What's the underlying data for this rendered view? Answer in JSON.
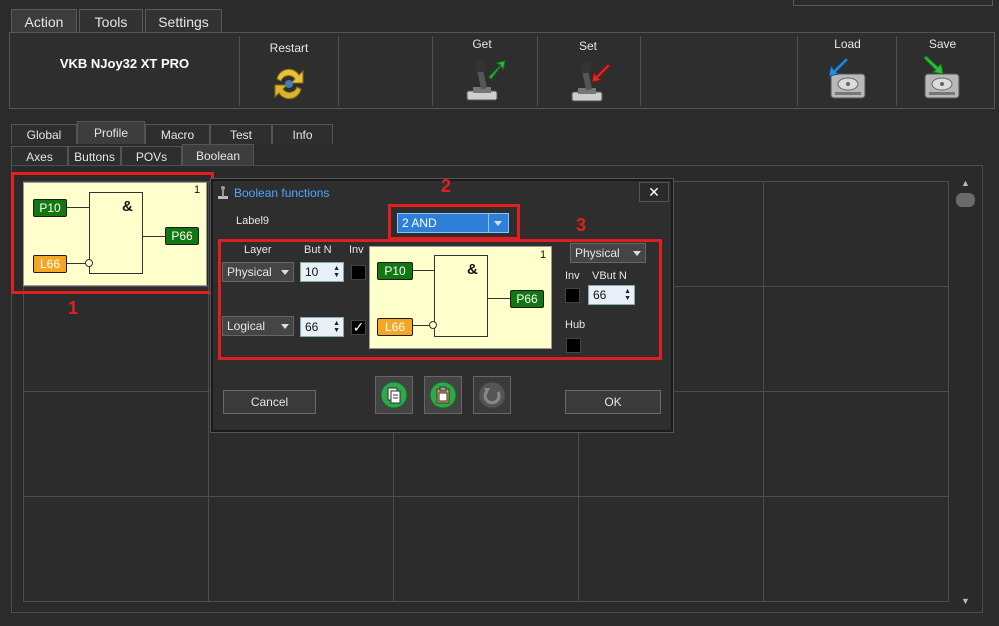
{
  "menu": {
    "tabs": [
      {
        "label": "Action",
        "active": true
      },
      {
        "label": "Tools",
        "active": false
      },
      {
        "label": "Settings",
        "active": false
      }
    ]
  },
  "toolbar": {
    "device_name": "VKB NJoy32 XT PRO",
    "restart_label": "Restart",
    "get_label": "Get",
    "set_label": "Set",
    "load_label": "Load",
    "save_label": "Save"
  },
  "section_tabs": [
    {
      "label": "Global",
      "active": false
    },
    {
      "label": "Profile",
      "active": true
    },
    {
      "label": "Macro",
      "active": false
    },
    {
      "label": "Test",
      "active": false
    },
    {
      "label": "Info",
      "active": false
    }
  ],
  "sub_tabs": [
    {
      "label": "Axes",
      "active": false
    },
    {
      "label": "Buttons",
      "active": false
    },
    {
      "label": "POVs",
      "active": false
    },
    {
      "label": "Boolean",
      "active": true
    }
  ],
  "gate_tile": {
    "number": "1",
    "input_a": "P10",
    "input_b": "L66",
    "output": "P66",
    "operator": "&"
  },
  "annotations": {
    "one": "1",
    "two": "2",
    "three": "3"
  },
  "dialog": {
    "title": "Boolean functions",
    "close": "✕",
    "label_name": "Label9",
    "function": "2 AND",
    "col_layer": "Layer",
    "col_butn": "But N",
    "col_inv": "Inv",
    "row1": {
      "layer": "Physical",
      "button": "10",
      "inv": ""
    },
    "row2": {
      "layer": "Logical",
      "button": "66",
      "inv": "✓"
    },
    "preview": {
      "number": "1",
      "input_a": "P10",
      "input_b": "L66",
      "output": "P66",
      "operator": "&"
    },
    "output_layer": "Physical",
    "out_inv_label": "Inv",
    "vbutn_label": "VBut N",
    "vbutn_value": "66",
    "hub_label": "Hub",
    "cancel_label": "Cancel",
    "ok_label": "OK"
  },
  "colors": {
    "accent": "#4aa8ff",
    "annotation": "#e02020",
    "pin_green": "#117711",
    "pin_orange": "#f5a623",
    "gate_bg": "#ffffcc"
  }
}
